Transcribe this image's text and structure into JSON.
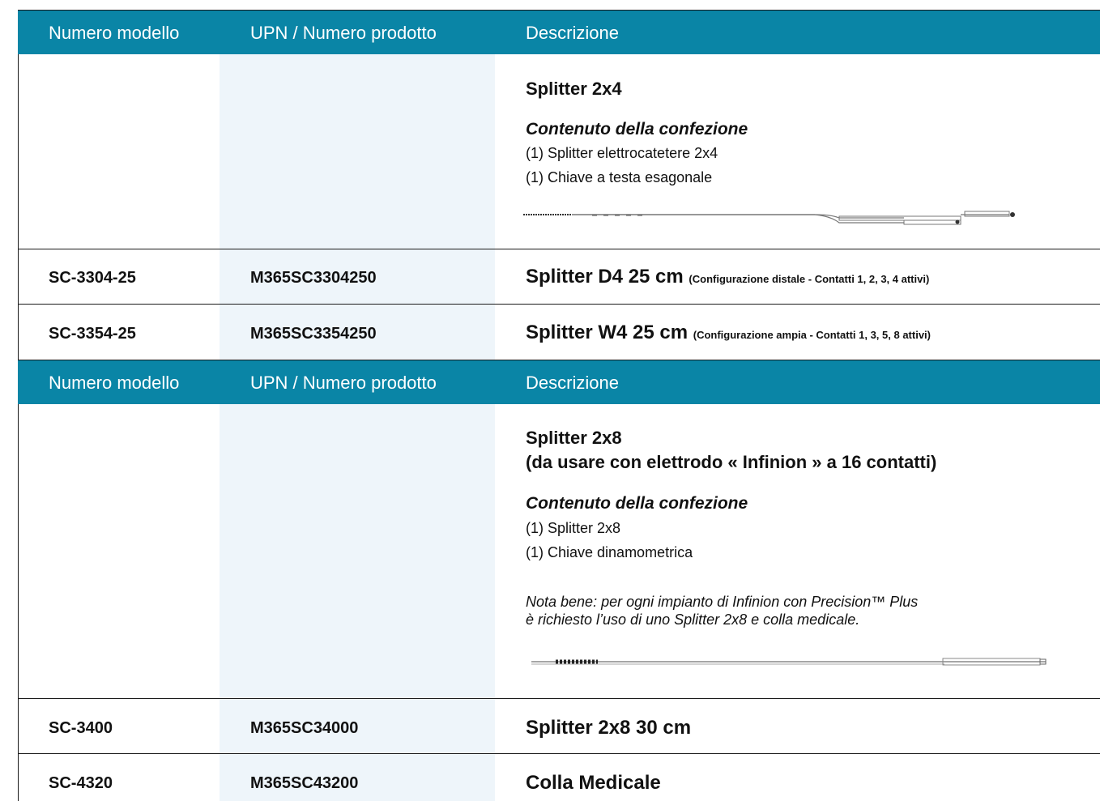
{
  "header": {
    "col_model": "Numero modello",
    "col_upn": "UPN / Numero prodotto",
    "col_desc": "Descrizione"
  },
  "section1": {
    "title": "Splitter 2x4",
    "contents_heading": "Contenuto della confezione",
    "contents": [
      "(1) Splitter elettrocatetere 2x4",
      "(1) Chiave a testa esagonale"
    ],
    "image_icon": "splitter-2x4-diagram",
    "rows": [
      {
        "model": "SC-3304-25",
        "upn": "M365SC3304250",
        "desc": "Splitter D4 25 cm",
        "desc_note": "(Configurazione distale - Contatti 1, 2, 3, 4 attivi)"
      },
      {
        "model": "SC-3354-25",
        "upn": "M365SC3354250",
        "desc": "Splitter W4 25 cm",
        "desc_note": "(Configurazione ampia - Contatti 1, 3, 5, 8 attivi)"
      }
    ]
  },
  "section2": {
    "title_line1": "Splitter 2x8",
    "title_line2": "(da usare con elettrodo « Infinion » a 16 contatti)",
    "contents_heading": "Contenuto della confezione",
    "contents": [
      "(1) Splitter 2x8",
      "(1) Chiave dinamometrica"
    ],
    "note_line1": "Nota bene: per ogni impianto di Infinion con Precision™ Plus",
    "note_line2": "è richiesto l’uso di uno Splitter 2x8 e colla medicale.",
    "image_icon": "splitter-2x8-diagram",
    "rows": [
      {
        "model": "SC-3400",
        "upn": "M365SC34000",
        "desc": "Splitter 2x8 30 cm"
      },
      {
        "model": "SC-4320",
        "upn": "M365SC43200",
        "desc": "Colla Medicale"
      }
    ]
  },
  "colors": {
    "header_bg": "#0a85a6",
    "stripe_bg": "#eef5fa"
  }
}
